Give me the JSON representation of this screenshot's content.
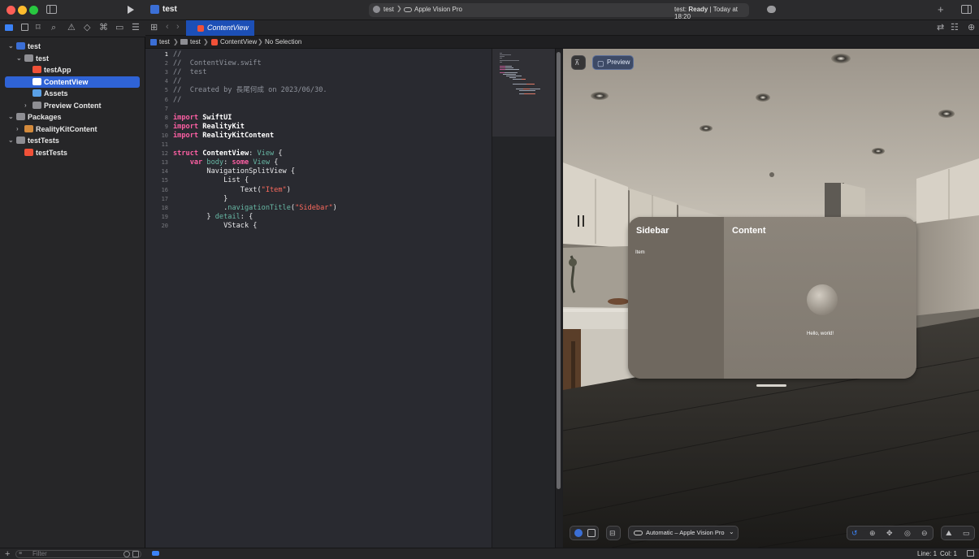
{
  "window": {
    "title": "test",
    "scheme": "test",
    "device": "Apple Vision Pro",
    "status_label": "test:",
    "status_value": "Ready",
    "status_time": "Today at 18:20"
  },
  "navigator": {
    "items": [
      {
        "label": "test",
        "depth": 0,
        "open": true,
        "kind": "project"
      },
      {
        "label": "test",
        "depth": 1,
        "open": true,
        "kind": "folder"
      },
      {
        "label": "testApp",
        "depth": 2,
        "kind": "swift"
      },
      {
        "label": "ContentView",
        "depth": 2,
        "kind": "swift",
        "selected": true
      },
      {
        "label": "Assets",
        "depth": 2,
        "kind": "assets"
      },
      {
        "label": "Preview Content",
        "depth": 2,
        "open": false,
        "kind": "folder"
      },
      {
        "label": "Packages",
        "depth": 0,
        "open": true,
        "kind": "folder"
      },
      {
        "label": "RealityKitContent",
        "depth": 1,
        "open": false,
        "kind": "package"
      },
      {
        "label": "testTests",
        "depth": 0,
        "open": true,
        "kind": "folder"
      },
      {
        "label": "testTests",
        "depth": 1,
        "kind": "swift"
      }
    ],
    "filter_placeholder": "Filter"
  },
  "editor": {
    "tab": "ContentView",
    "breadcrumb": [
      "test",
      "test",
      "ContentView",
      "No Selection"
    ],
    "lines": [
      [
        [
          "//",
          "c"
        ]
      ],
      [
        [
          "//  ContentView.swift",
          "c"
        ]
      ],
      [
        [
          "//  test",
          "c"
        ]
      ],
      [
        [
          "//",
          "c"
        ]
      ],
      [
        [
          "//  Created by 長尾何成 on 2023/06/30.",
          "c"
        ]
      ],
      [
        [
          "//",
          "c"
        ]
      ],
      [],
      [
        [
          "import",
          "k"
        ],
        [
          " SwiftUI",
          "b"
        ]
      ],
      [
        [
          "import",
          "k"
        ],
        [
          " RealityKit",
          "b"
        ]
      ],
      [
        [
          "import",
          "k"
        ],
        [
          " RealityKitContent",
          "b"
        ]
      ],
      [],
      [
        [
          "struct",
          "k"
        ],
        [
          " ContentView",
          "b"
        ],
        [
          ": ",
          "p"
        ],
        [
          "View",
          "t"
        ],
        [
          " {",
          "p"
        ]
      ],
      [
        [
          "    "
        ],
        [
          "var",
          "k"
        ],
        [
          " body",
          "t"
        ],
        [
          ": ",
          "p"
        ],
        [
          "some",
          "k"
        ],
        [
          " ",
          "p"
        ],
        [
          "View",
          "t"
        ],
        [
          " {",
          "p"
        ]
      ],
      [
        [
          "        NavigationSplitView {",
          "p"
        ]
      ],
      [
        [
          "            List {",
          "p"
        ]
      ],
      [
        [
          "                Text(",
          "p"
        ],
        [
          "\"Item\"",
          "s"
        ],
        [
          ")",
          "p"
        ]
      ],
      [
        [
          "            }",
          "p"
        ]
      ],
      [
        [
          "            .",
          "p"
        ],
        [
          "navigationTitle",
          "t"
        ],
        [
          "(",
          "p"
        ],
        [
          "\"Sidebar\"",
          "s"
        ],
        [
          ")",
          "p"
        ]
      ],
      [
        [
          "        } ",
          "p"
        ],
        [
          "detail",
          "t"
        ],
        [
          ": {",
          "p"
        ]
      ],
      [
        [
          "            VStack {",
          "p"
        ]
      ]
    ]
  },
  "preview": {
    "button": "Preview",
    "sidebar_title": "Sidebar",
    "sidebar_item": "Item",
    "content_title": "Content",
    "content_text": "Hello, world!",
    "device_menu": "Automatic – Apple Vision Pro"
  },
  "status": {
    "line_label": "Line: 1",
    "col_label": "Col: 1"
  }
}
